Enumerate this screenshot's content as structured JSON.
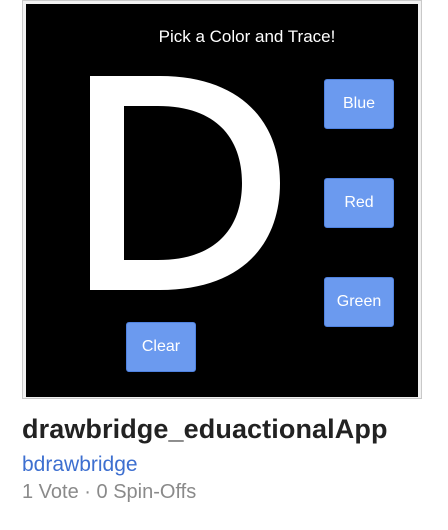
{
  "thumbnail": {
    "app_title": "Pick a Color and Trace!",
    "big_letter": "D",
    "buttons": {
      "blue": "Blue",
      "red": "Red",
      "green": "Green",
      "clear": "Clear"
    },
    "canvas_color": "#000000",
    "button_color": "#6b9aef"
  },
  "project": {
    "title": "drawbridge_eduactionalApp",
    "author": "bdrawbridge",
    "votes": "1 Vote",
    "separator": "·",
    "spinoffs": "0 Spin-Offs"
  }
}
